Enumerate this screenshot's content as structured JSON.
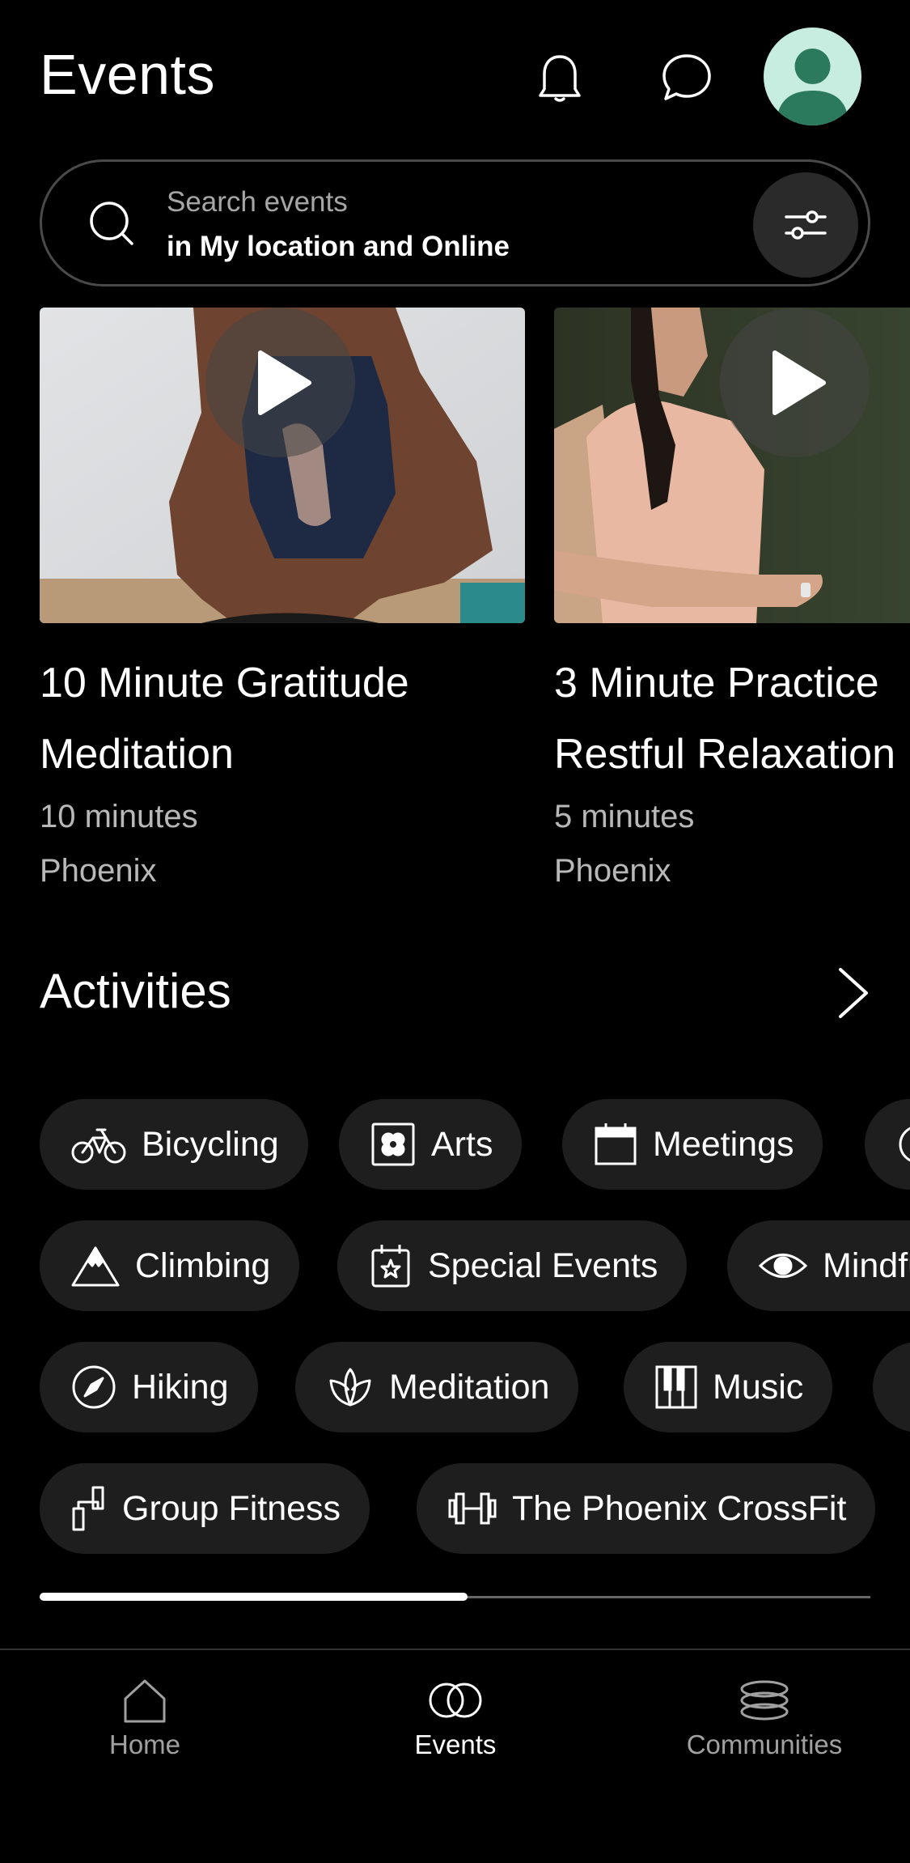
{
  "header": {
    "title": "Events",
    "icons": [
      "bell-icon",
      "chat-icon"
    ]
  },
  "search": {
    "placeholder": "Search events",
    "scope": "in My location and Online"
  },
  "featured": [
    {
      "title_line1": "10 Minute Gratitude",
      "title_line2": "Meditation",
      "duration": "10 minutes",
      "location": "Phoenix"
    },
    {
      "title_line1": "3 Minute Practice",
      "title_line2": "Restful Relaxation",
      "duration": "5 minutes",
      "location": "Phoenix"
    }
  ],
  "activities": {
    "title": "Activities",
    "chips": [
      {
        "label": "Bicycling",
        "icon": "bicycle-icon"
      },
      {
        "label": "Arts",
        "icon": "arts-icon"
      },
      {
        "label": "Meetings",
        "icon": "calendar-icon"
      },
      {
        "label": "Climbing",
        "icon": "mountain-icon"
      },
      {
        "label": "Special Events",
        "icon": "calendar-star-icon"
      },
      {
        "label": "Mindfulness",
        "icon": "eye-icon"
      },
      {
        "label": "Hiking",
        "icon": "compass-icon"
      },
      {
        "label": "Meditation",
        "icon": "lotus-icon"
      },
      {
        "label": "Music",
        "icon": "piano-icon"
      },
      {
        "label": "Group Fitness",
        "icon": "fitness-icon"
      },
      {
        "label": "The Phoenix CrossFit",
        "icon": "dumbbell-icon"
      }
    ],
    "scroll_progress": 0.515
  },
  "nav": {
    "items": [
      {
        "label": "Home",
        "icon": "home-icon",
        "active": false
      },
      {
        "label": "Events",
        "icon": "events-icon",
        "active": true
      },
      {
        "label": "Communities",
        "icon": "communities-icon",
        "active": false
      }
    ]
  },
  "colors": {
    "background": "#000000",
    "chip": "#1e1e1e",
    "muted_text": "#b8b8b8",
    "avatar": "#c6ede0",
    "avatar_figure": "#2c7a5e",
    "nav_inactive": "#a0a0a0"
  }
}
